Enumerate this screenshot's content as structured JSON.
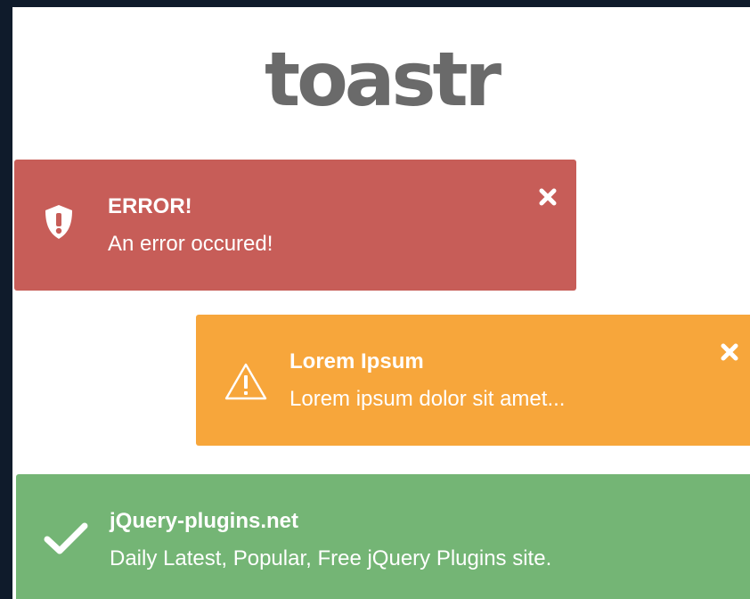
{
  "logo": {
    "text": "toastr"
  },
  "toasts": {
    "error": {
      "icon": "shield-exclamation-icon",
      "title": "ERROR!",
      "message": "An error occured!",
      "color": "#c75d58",
      "has_close": true
    },
    "warning": {
      "icon": "warning-triangle-icon",
      "title": "Lorem Ipsum",
      "message": "Lorem ipsum dolor sit amet...",
      "color": "#f7a63b",
      "has_close": true
    },
    "success": {
      "icon": "checkmark-icon",
      "title": "jQuery-plugins.net",
      "message": "Daily Latest, Popular, Free jQuery Plugins site.",
      "color": "#74b575",
      "has_close": false
    }
  },
  "colors": {
    "frame_background": "#0f1b2b",
    "page_background": "#ffffff",
    "logo_text": "#6a6a6a"
  }
}
